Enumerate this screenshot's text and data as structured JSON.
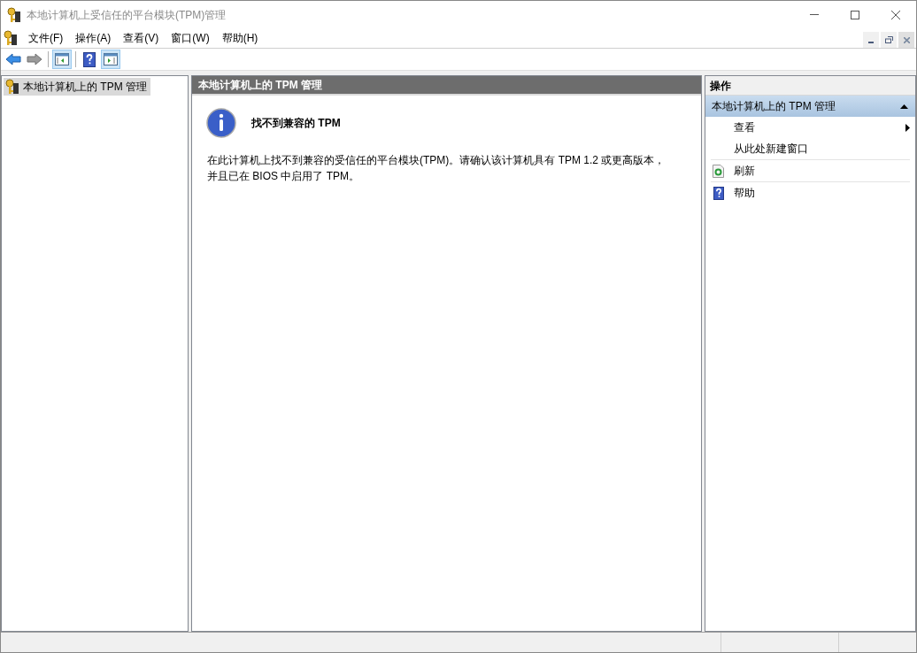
{
  "window": {
    "title": "本地计算机上受信任的平台模块(TPM)管理",
    "active": false
  },
  "menu": [
    "文件(F)",
    "操作(A)",
    "查看(V)",
    "窗口(W)",
    "帮助(H)"
  ],
  "toolbar": [
    {
      "kind": "back",
      "pressed": false
    },
    {
      "kind": "forward",
      "pressed": false
    },
    {
      "kind": "tree-toggle",
      "pressed": true
    },
    {
      "kind": "help",
      "pressed": false
    },
    {
      "kind": "action-toggle",
      "pressed": true
    }
  ],
  "tree": [
    {
      "label": "本地计算机上的 TPM 管理",
      "selected": true
    }
  ],
  "content": {
    "header": "本地计算机上的 TPM 管理",
    "message_title": "找不到兼容的 TPM",
    "message_lines": [
      "在此计算机上找不到兼容的受信任的平台模块(TPM)。请确认该计算机具有 TPM 1.2 或更高版本，",
      "并且已在 BIOS 中启用了 TPM。"
    ]
  },
  "actions": {
    "header": "操作",
    "group": {
      "title": "本地计算机上的 TPM 管理",
      "expanded": true,
      "items": [
        {
          "label": "查看",
          "kind": "submenu",
          "separator_before": false
        },
        {
          "label": "从此处新建窗口",
          "kind": "plain",
          "separator_before": false
        },
        {
          "label": "刷新",
          "kind": "refresh",
          "separator_before": true
        },
        {
          "label": "帮助",
          "kind": "help",
          "separator_before": true
        }
      ]
    }
  }
}
